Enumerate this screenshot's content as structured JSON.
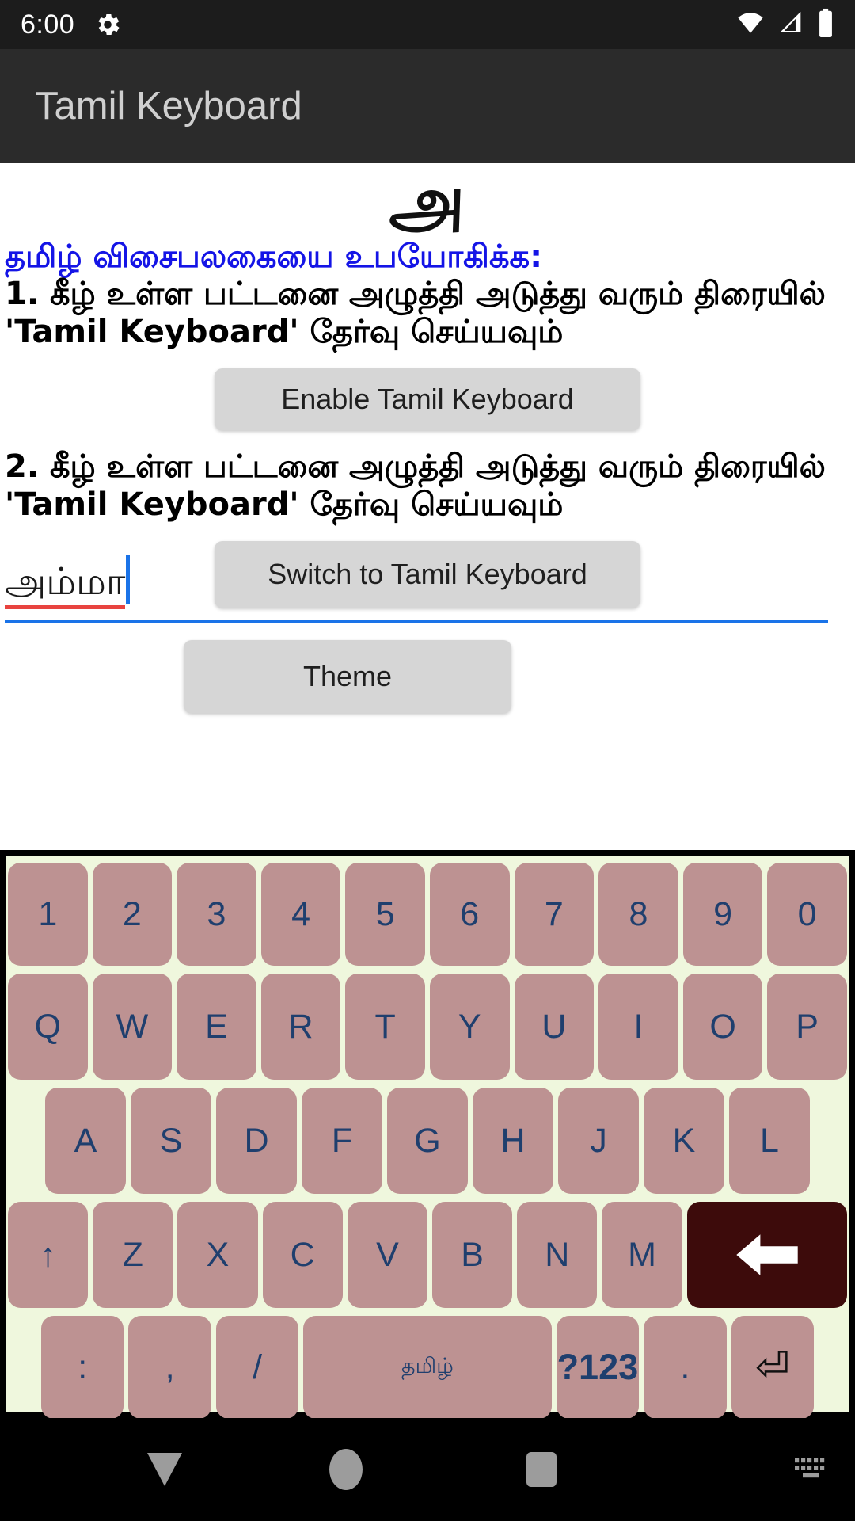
{
  "status_bar": {
    "time": "6:00",
    "gear_icon": "gear-icon",
    "wifi_icon": "wifi-icon",
    "signal_icon": "cell-signal-icon",
    "battery_icon": "battery-icon"
  },
  "app_bar": {
    "title": "Tamil Keyboard"
  },
  "content": {
    "logo_glyph": "அ",
    "heading": "தமிழ் விசைபலகையை உபயோகிக்க:",
    "instruction_1": "1. கீழ் உள்ள பட்டனை அழுத்தி அடுத்து வரும் திரையில் 'Tamil Keyboard' தேர்வு செய்யவும்",
    "enable_button": "Enable Tamil Keyboard",
    "instruction_2": "2. கீழ் உள்ள பட்டனை அழுத்தி அடுத்து வரும் திரையில் 'Tamil Keyboard' தேர்வு செய்யவும்",
    "switch_button": "Switch to Tamil Keyboard",
    "input_value": "அம்மா",
    "theme_button": "Theme"
  },
  "colors": {
    "heading_blue": "#1414e6",
    "key_face": "#bd9292",
    "key_text": "#1f3f6e",
    "keyboard_bg": "#eff7dd",
    "backspace_bg": "#3d0b0b",
    "spellcheck_red": "#e8433f",
    "caret_blue": "#1a73e8",
    "appbar_bg": "#2b2b2b",
    "statusbar_bg": "#1c1c1c"
  },
  "keyboard": {
    "rows": [
      {
        "name": "number-row",
        "keys": [
          {
            "label": "1",
            "name": "key-1",
            "flex": 1
          },
          {
            "label": "2",
            "name": "key-2",
            "flex": 1
          },
          {
            "label": "3",
            "name": "key-3",
            "flex": 1
          },
          {
            "label": "4",
            "name": "key-4",
            "flex": 1
          },
          {
            "label": "5",
            "name": "key-5",
            "flex": 1
          },
          {
            "label": "6",
            "name": "key-6",
            "flex": 1
          },
          {
            "label": "7",
            "name": "key-7",
            "flex": 1
          },
          {
            "label": "8",
            "name": "key-8",
            "flex": 1
          },
          {
            "label": "9",
            "name": "key-9",
            "flex": 1
          },
          {
            "label": "0",
            "name": "key-0",
            "flex": 1
          }
        ]
      },
      {
        "name": "qwerty-row",
        "keys": [
          {
            "label": "Q",
            "name": "key-q",
            "flex": 1
          },
          {
            "label": "W",
            "name": "key-w",
            "flex": 1
          },
          {
            "label": "E",
            "name": "key-e",
            "flex": 1
          },
          {
            "label": "R",
            "name": "key-r",
            "flex": 1
          },
          {
            "label": "T",
            "name": "key-t",
            "flex": 1
          },
          {
            "label": "Y",
            "name": "key-y",
            "flex": 1
          },
          {
            "label": "U",
            "name": "key-u",
            "flex": 1
          },
          {
            "label": "I",
            "name": "key-i",
            "flex": 1
          },
          {
            "label": "O",
            "name": "key-o",
            "flex": 1
          },
          {
            "label": "P",
            "name": "key-p",
            "flex": 1
          }
        ]
      },
      {
        "name": "asdf-row",
        "keys": [
          {
            "label": "A",
            "name": "key-a",
            "flex": 1
          },
          {
            "label": "S",
            "name": "key-s",
            "flex": 1
          },
          {
            "label": "D",
            "name": "key-d",
            "flex": 1
          },
          {
            "label": "F",
            "name": "key-f",
            "flex": 1
          },
          {
            "label": "G",
            "name": "key-g",
            "flex": 1
          },
          {
            "label": "H",
            "name": "key-h",
            "flex": 1
          },
          {
            "label": "J",
            "name": "key-j",
            "flex": 1
          },
          {
            "label": "K",
            "name": "key-k",
            "flex": 1
          },
          {
            "label": "L",
            "name": "key-l",
            "flex": 1
          }
        ]
      },
      {
        "name": "zxcv-row",
        "keys": [
          {
            "label": "↑",
            "name": "key-shift",
            "flex": 1
          },
          {
            "label": "Z",
            "name": "key-z",
            "flex": 1
          },
          {
            "label": "X",
            "name": "key-x",
            "flex": 1
          },
          {
            "label": "C",
            "name": "key-c",
            "flex": 1
          },
          {
            "label": "V",
            "name": "key-v",
            "flex": 1
          },
          {
            "label": "B",
            "name": "key-b",
            "flex": 1
          },
          {
            "label": "N",
            "name": "key-n",
            "flex": 1
          },
          {
            "label": "M",
            "name": "key-m",
            "flex": 1
          },
          {
            "label": "",
            "name": "key-backspace",
            "flex": 2
          }
        ]
      },
      {
        "name": "bottom-row",
        "keys": [
          {
            "label": ":",
            "name": "key-colon",
            "flex": 1
          },
          {
            "label": ",",
            "name": "key-comma",
            "flex": 1
          },
          {
            "label": "/",
            "name": "key-slash",
            "flex": 1
          },
          {
            "label": "தமிழ்",
            "name": "key-space",
            "flex": 3
          },
          {
            "label": "?123",
            "name": "key-symbols",
            "flex": 1
          },
          {
            "label": ".",
            "name": "key-period",
            "flex": 1
          },
          {
            "label": "⏎",
            "name": "key-enter",
            "flex": 1
          }
        ]
      }
    ]
  },
  "nav_bar": {
    "back": "back-icon",
    "home": "home-icon",
    "recents": "recents-icon",
    "keyboard_switcher": "keyboard-switch-icon"
  }
}
